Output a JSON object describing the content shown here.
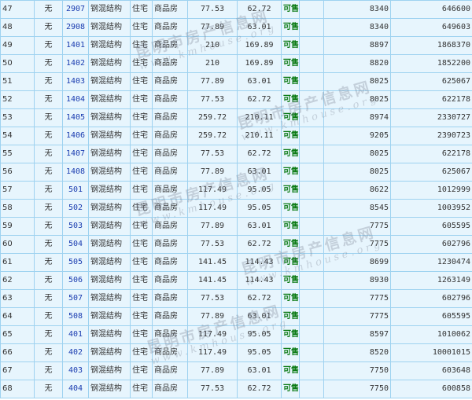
{
  "watermark": {
    "name": "昆明市房产信息网",
    "url": "www.kmhouse.org"
  },
  "rows": [
    {
      "index": "47",
      "presale": "无",
      "room": "2907",
      "structure": "钢混结构",
      "use": "住宅",
      "type": "商品房",
      "area": "77.53",
      "inner_area": "62.72",
      "status": "可售",
      "unit_price": "8340",
      "total_price": "646600"
    },
    {
      "index": "48",
      "presale": "无",
      "room": "2908",
      "structure": "钢混结构",
      "use": "住宅",
      "type": "商品房",
      "area": "77.89",
      "inner_area": "63.01",
      "status": "可售",
      "unit_price": "8340",
      "total_price": "649603"
    },
    {
      "index": "49",
      "presale": "无",
      "room": "1401",
      "structure": "钢混结构",
      "use": "住宅",
      "type": "商品房",
      "area": "210",
      "inner_area": "169.89",
      "status": "可售",
      "unit_price": "8897",
      "total_price": "1868370"
    },
    {
      "index": "50",
      "presale": "无",
      "room": "1402",
      "structure": "钢混结构",
      "use": "住宅",
      "type": "商品房",
      "area": "210",
      "inner_area": "169.89",
      "status": "可售",
      "unit_price": "8820",
      "total_price": "1852200"
    },
    {
      "index": "51",
      "presale": "无",
      "room": "1403",
      "structure": "钢混结构",
      "use": "住宅",
      "type": "商品房",
      "area": "77.89",
      "inner_area": "63.01",
      "status": "可售",
      "unit_price": "8025",
      "total_price": "625067"
    },
    {
      "index": "52",
      "presale": "无",
      "room": "1404",
      "structure": "钢混结构",
      "use": "住宅",
      "type": "商品房",
      "area": "77.53",
      "inner_area": "62.72",
      "status": "可售",
      "unit_price": "8025",
      "total_price": "622178"
    },
    {
      "index": "53",
      "presale": "无",
      "room": "1405",
      "structure": "钢混结构",
      "use": "住宅",
      "type": "商品房",
      "area": "259.72",
      "inner_area": "210.11",
      "status": "可售",
      "unit_price": "8974",
      "total_price": "2330727"
    },
    {
      "index": "54",
      "presale": "无",
      "room": "1406",
      "structure": "钢混结构",
      "use": "住宅",
      "type": "商品房",
      "area": "259.72",
      "inner_area": "210.11",
      "status": "可售",
      "unit_price": "9205",
      "total_price": "2390723"
    },
    {
      "index": "55",
      "presale": "无",
      "room": "1407",
      "structure": "钢混结构",
      "use": "住宅",
      "type": "商品房",
      "area": "77.53",
      "inner_area": "62.72",
      "status": "可售",
      "unit_price": "8025",
      "total_price": "622178"
    },
    {
      "index": "56",
      "presale": "无",
      "room": "1408",
      "structure": "钢混结构",
      "use": "住宅",
      "type": "商品房",
      "area": "77.89",
      "inner_area": "63.01",
      "status": "可售",
      "unit_price": "8025",
      "total_price": "625067"
    },
    {
      "index": "57",
      "presale": "无",
      "room": "501",
      "structure": "钢混结构",
      "use": "住宅",
      "type": "商品房",
      "area": "117.49",
      "inner_area": "95.05",
      "status": "可售",
      "unit_price": "8622",
      "total_price": "1012999"
    },
    {
      "index": "58",
      "presale": "无",
      "room": "502",
      "structure": "钢混结构",
      "use": "住宅",
      "type": "商品房",
      "area": "117.49",
      "inner_area": "95.05",
      "status": "可售",
      "unit_price": "8545",
      "total_price": "1003952"
    },
    {
      "index": "59",
      "presale": "无",
      "room": "503",
      "structure": "钢混结构",
      "use": "住宅",
      "type": "商品房",
      "area": "77.89",
      "inner_area": "63.01",
      "status": "可售",
      "unit_price": "7775",
      "total_price": "605595"
    },
    {
      "index": "60",
      "presale": "无",
      "room": "504",
      "structure": "钢混结构",
      "use": "住宅",
      "type": "商品房",
      "area": "77.53",
      "inner_area": "62.72",
      "status": "可售",
      "unit_price": "7775",
      "total_price": "602796"
    },
    {
      "index": "61",
      "presale": "无",
      "room": "505",
      "structure": "钢混结构",
      "use": "住宅",
      "type": "商品房",
      "area": "141.45",
      "inner_area": "114.43",
      "status": "可售",
      "unit_price": "8699",
      "total_price": "1230474"
    },
    {
      "index": "62",
      "presale": "无",
      "room": "506",
      "structure": "钢混结构",
      "use": "住宅",
      "type": "商品房",
      "area": "141.45",
      "inner_area": "114.43",
      "status": "可售",
      "unit_price": "8930",
      "total_price": "1263149"
    },
    {
      "index": "63",
      "presale": "无",
      "room": "507",
      "structure": "钢混结构",
      "use": "住宅",
      "type": "商品房",
      "area": "77.53",
      "inner_area": "62.72",
      "status": "可售",
      "unit_price": "7775",
      "total_price": "602796"
    },
    {
      "index": "64",
      "presale": "无",
      "room": "508",
      "structure": "钢混结构",
      "use": "住宅",
      "type": "商品房",
      "area": "77.89",
      "inner_area": "63.01",
      "status": "可售",
      "unit_price": "7775",
      "total_price": "605595"
    },
    {
      "index": "65",
      "presale": "无",
      "room": "401",
      "structure": "钢混结构",
      "use": "住宅",
      "type": "商品房",
      "area": "117.49",
      "inner_area": "95.05",
      "status": "可售",
      "unit_price": "8597",
      "total_price": "1010062"
    },
    {
      "index": "66",
      "presale": "无",
      "room": "402",
      "structure": "钢混结构",
      "use": "住宅",
      "type": "商品房",
      "area": "117.49",
      "inner_area": "95.05",
      "status": "可售",
      "unit_price": "8520",
      "total_price": "10001015"
    },
    {
      "index": "67",
      "presale": "无",
      "room": "403",
      "structure": "钢混结构",
      "use": "住宅",
      "type": "商品房",
      "area": "77.89",
      "inner_area": "63.01",
      "status": "可售",
      "unit_price": "7750",
      "total_price": "603648"
    },
    {
      "index": "68",
      "presale": "无",
      "room": "404",
      "structure": "钢混结构",
      "use": "住宅",
      "type": "商品房",
      "area": "77.53",
      "inner_area": "62.72",
      "status": "可售",
      "unit_price": "7750",
      "total_price": "600858"
    }
  ]
}
